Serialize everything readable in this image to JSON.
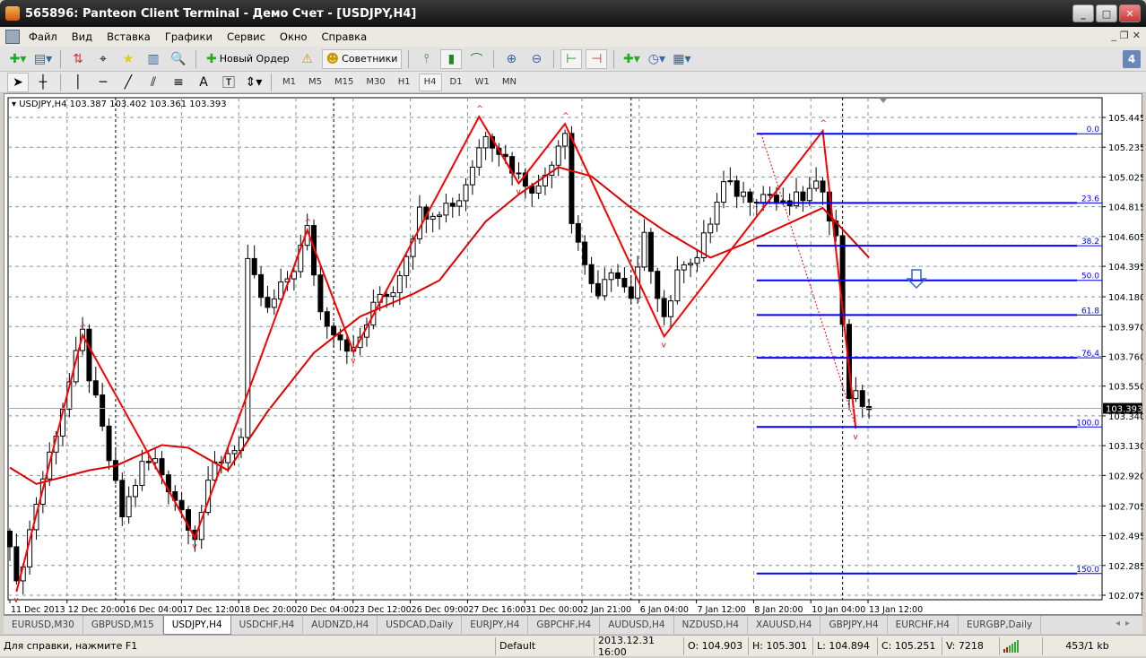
{
  "window": {
    "title": "565896: Panteon Client Terminal - Демо Счет - [USDJPY,H4]"
  },
  "menu": [
    "Файл",
    "Вид",
    "Вставка",
    "Графики",
    "Сервис",
    "Окно",
    "Справка"
  ],
  "toolbar": {
    "new_order": "Новый Ордер",
    "experts": "Советники",
    "notifications": "4"
  },
  "line_tools": {
    "text_tool": "A"
  },
  "timeframes": [
    "M1",
    "M5",
    "M15",
    "M30",
    "H1",
    "H4",
    "D1",
    "W1",
    "MN"
  ],
  "active_timeframe": "H4",
  "chart_header": "USDJPY,H4  103.387 103.402 103.361 103.393",
  "chart_data": {
    "type": "candlestick",
    "symbol": "USDJPY",
    "timeframe": "H4",
    "ylim": [
      102.075,
      105.445
    ],
    "price_ticks": [
      "105.445",
      "105.235",
      "105.025",
      "104.815",
      "104.605",
      "104.395",
      "104.180",
      "103.970",
      "103.760",
      "103.550",
      "103.340",
      "103.130",
      "102.920",
      "102.705",
      "102.495",
      "102.285",
      "102.075"
    ],
    "time_ticks": [
      "11 Dec 2013",
      "12 Dec 20:00",
      "16 Dec 04:00",
      "17 Dec 12:00",
      "18 Dec 20:00",
      "20 Dec 04:00",
      "23 Dec 12:00",
      "26 Dec 09:00",
      "27 Dec 16:00",
      "31 Dec 00:00",
      "2 Jan 21:00",
      "6 Jan 04:00",
      "7 Jan 12:00",
      "8 Jan 20:00",
      "10 Jan 04:00",
      "13 Jan 12:00"
    ],
    "bar_count": 131,
    "close_waypoints": [
      [
        0,
        102.477
      ],
      [
        1,
        102.126
      ],
      [
        4,
        102.732
      ],
      [
        11,
        103.913
      ],
      [
        12,
        103.626
      ],
      [
        17,
        102.636
      ],
      [
        20,
        102.988
      ],
      [
        22,
        103.019
      ],
      [
        28,
        102.509
      ],
      [
        31,
        102.988
      ],
      [
        35,
        103.179
      ],
      [
        36,
        104.392
      ],
      [
        39,
        104.073
      ],
      [
        43,
        104.392
      ],
      [
        45,
        104.647
      ],
      [
        47,
        104.073
      ],
      [
        52,
        103.785
      ],
      [
        56,
        104.2
      ],
      [
        58,
        104.232
      ],
      [
        62,
        104.775
      ],
      [
        65,
        104.807
      ],
      [
        68,
        104.871
      ],
      [
        72,
        105.349
      ],
      [
        77,
        105.03
      ],
      [
        80,
        104.934
      ],
      [
        84,
        105.381
      ],
      [
        85,
        104.711
      ],
      [
        89,
        104.136
      ],
      [
        91,
        104.392
      ],
      [
        94,
        104.136
      ],
      [
        96,
        104.583
      ],
      [
        99,
        104.041
      ],
      [
        102,
        104.456
      ],
      [
        104,
        104.456
      ],
      [
        108,
        104.966
      ],
      [
        111,
        104.902
      ],
      [
        115,
        104.902
      ],
      [
        117,
        104.807
      ],
      [
        123,
        104.966
      ],
      [
        125,
        104.583
      ],
      [
        126,
        104.009
      ],
      [
        127,
        103.498
      ],
      [
        129,
        103.434
      ],
      [
        130,
        103.393
      ]
    ],
    "moving_average": [
      [
        0,
        102.975
      ],
      [
        4,
        102.86
      ],
      [
        12,
        102.956
      ],
      [
        16,
        102.988
      ],
      [
        23,
        103.134
      ],
      [
        27,
        103.115
      ],
      [
        33,
        102.956
      ],
      [
        39,
        103.371
      ],
      [
        46,
        103.785
      ],
      [
        53,
        104.041
      ],
      [
        61,
        104.2
      ],
      [
        65,
        104.296
      ],
      [
        72,
        104.711
      ],
      [
        77,
        104.902
      ],
      [
        83,
        105.094
      ],
      [
        88,
        105.03
      ],
      [
        94,
        104.807
      ],
      [
        99,
        104.647
      ],
      [
        106,
        104.456
      ],
      [
        111,
        104.551
      ],
      [
        117,
        104.679
      ],
      [
        123,
        104.807
      ],
      [
        130,
        104.456
      ]
    ],
    "zigzag": [
      [
        1,
        102.1
      ],
      [
        11,
        103.91
      ],
      [
        28,
        102.48
      ],
      [
        45,
        104.65
      ],
      [
        52,
        103.79
      ],
      [
        71,
        105.45
      ],
      [
        77,
        104.98
      ],
      [
        84,
        105.4
      ],
      [
        99,
        103.9
      ],
      [
        123,
        105.35
      ],
      [
        128,
        103.25
      ]
    ],
    "fibonacci": {
      "high": 105.33,
      "low": 103.262,
      "start_bar": 113,
      "levels": [
        {
          "label": "0.0",
          "ratio": 0
        },
        {
          "label": "23.6",
          "ratio": 0.236
        },
        {
          "label": "38.2",
          "ratio": 0.382
        },
        {
          "label": "50.0",
          "ratio": 0.5
        },
        {
          "label": "61.8",
          "ratio": 0.618
        },
        {
          "label": "76.4",
          "ratio": 0.764
        },
        {
          "label": "100.0",
          "ratio": 1
        },
        {
          "label": "150.0",
          "ratio": 1.5
        }
      ]
    },
    "current_price": "103.393",
    "day_separator_bars": [
      16,
      49,
      94,
      126
    ],
    "colors": {
      "bull": "#ffffff",
      "bear": "#000000",
      "zigzag": "#ff0000",
      "ma": "#e00000",
      "fib": "#0000ff",
      "grid": "#8090a0"
    }
  },
  "tabs": [
    "EURUSD,M30",
    "GBPUSD,M15",
    "USDJPY,H4",
    "USDCHF,H4",
    "AUDNZD,H4",
    "USDCAD,Daily",
    "EURJPY,H4",
    "GBPCHF,H4",
    "AUDUSD,H4",
    "NZDUSD,H4",
    "XAUUSD,H4",
    "GBPJPY,H4",
    "EURCHF,H4",
    "EURGBP,Daily"
  ],
  "active_tab": "USDJPY,H4",
  "status": {
    "help": "Для справки, нажмите F1",
    "profile": "Default",
    "datetime": "2013.12.31 16:00",
    "open": "O: 104.903",
    "high": "H: 105.301",
    "low": "L: 104.894",
    "close": "C: 105.251",
    "volume": "V: 7218",
    "traffic": "453/1 kb"
  }
}
